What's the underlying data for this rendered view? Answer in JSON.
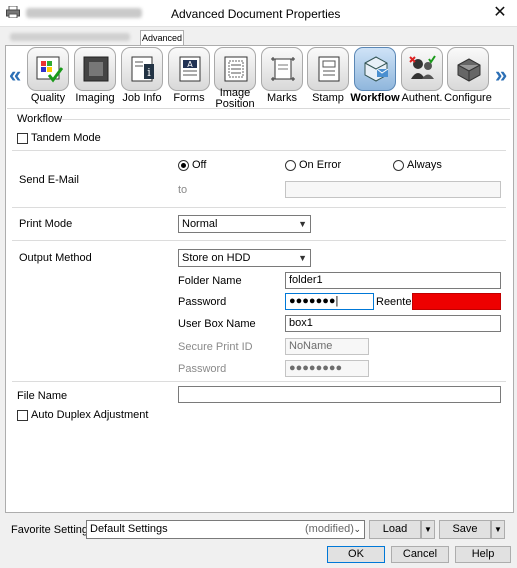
{
  "window": {
    "title": "Advanced Document Properties",
    "close_glyph": "✕"
  },
  "tabs": {
    "active": "Advanced"
  },
  "toolbar": {
    "items": [
      {
        "label": "Quality",
        "icon": "quality-icon"
      },
      {
        "label": "Imaging",
        "icon": "imaging-icon"
      },
      {
        "label": "Job Info",
        "icon": "job-info-icon"
      },
      {
        "label": "Forms",
        "icon": "forms-icon"
      },
      {
        "label": "Image Position",
        "icon": "image-position-icon"
      },
      {
        "label": "Marks",
        "icon": "marks-icon"
      },
      {
        "label": "Stamp",
        "icon": "stamp-icon"
      },
      {
        "label": "Workflow",
        "icon": "workflow-icon",
        "selected": true
      },
      {
        "label": "Authent.",
        "icon": "authentication-icon"
      },
      {
        "label": "Configure",
        "icon": "configure-icon"
      }
    ],
    "prev_glyph": "«",
    "next_glyph": "»"
  },
  "workflow": {
    "group_title": "Workflow",
    "tandem_mode": {
      "label": "Tandem Mode",
      "checked": false
    },
    "send_email": {
      "label": "Send E-Mail",
      "options": [
        "Off",
        "On Error",
        "Always"
      ],
      "selected": "Off",
      "to_label": "to",
      "to_value": ""
    },
    "print_mode": {
      "label": "Print Mode",
      "value": "Normal"
    },
    "output_method": {
      "label": "Output Method",
      "value": "Store on HDD",
      "folder_name_label": "Folder Name",
      "folder_name_value": "folder1",
      "password_label": "Password",
      "password_value": "●●●●●●●",
      "reenter_label": "Reenter",
      "user_box_name_label": "User Box Name",
      "user_box_name_value": "box1",
      "secure_print_id_label": "Secure Print ID",
      "secure_print_id_value": "NoName",
      "secure_password_label": "Password",
      "secure_password_value": "●●●●●●●●"
    },
    "file_name": {
      "label": "File Name",
      "value": ""
    },
    "auto_duplex": {
      "label": "Auto Duplex Adjustment",
      "checked": false
    }
  },
  "favorite": {
    "label": "Favorite Setting",
    "value": "Default Settings",
    "status": "(modified)",
    "load_label": "Load",
    "save_label": "Save"
  },
  "footer": {
    "ok_label": "OK",
    "cancel_label": "Cancel",
    "help_label": "Help"
  },
  "colors": {
    "accent": "#0078d7",
    "reenter_error": "#ee0000",
    "nav_arrow": "#2c6fb5"
  }
}
